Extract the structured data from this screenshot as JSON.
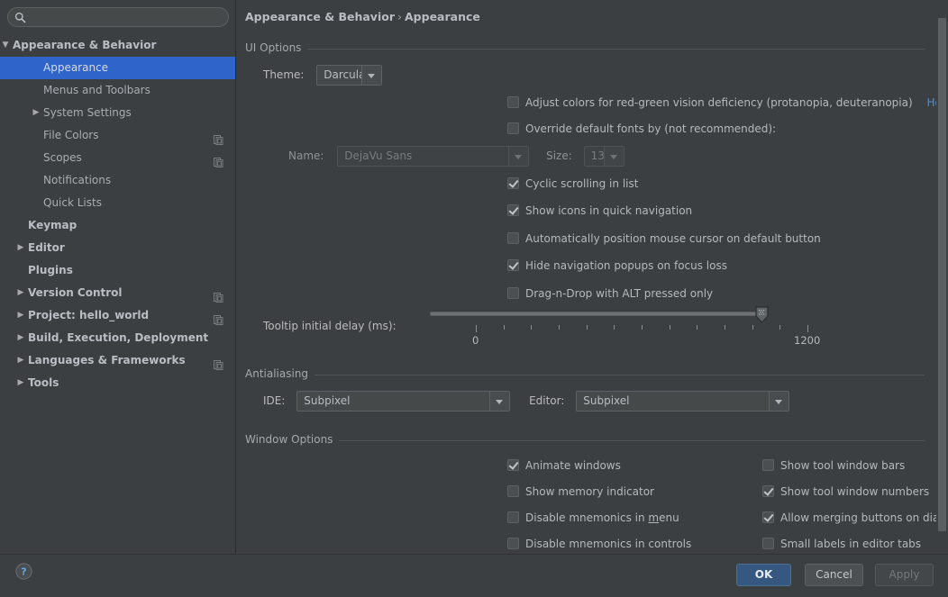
{
  "search": {
    "value": "",
    "placeholder": "",
    "icon": "search-icon"
  },
  "sidebar": {
    "items": [
      {
        "label": "Appearance & Behavior",
        "indent": 14,
        "arrow": "▼",
        "bold": true,
        "selected": false,
        "copy": false
      },
      {
        "label": "Appearance",
        "indent": 48,
        "arrow": "",
        "bold": false,
        "selected": true,
        "copy": false
      },
      {
        "label": "Menus and Toolbars",
        "indent": 48,
        "arrow": "",
        "bold": false,
        "selected": false,
        "copy": false
      },
      {
        "label": "System Settings",
        "indent": 48,
        "arrow": "▶",
        "bold": false,
        "selected": false,
        "copy": false
      },
      {
        "label": "File Colors",
        "indent": 48,
        "arrow": "",
        "bold": false,
        "selected": false,
        "copy": true
      },
      {
        "label": "Scopes",
        "indent": 48,
        "arrow": "",
        "bold": false,
        "selected": false,
        "copy": true
      },
      {
        "label": "Notifications",
        "indent": 48,
        "arrow": "",
        "bold": false,
        "selected": false,
        "copy": false
      },
      {
        "label": "Quick Lists",
        "indent": 48,
        "arrow": "",
        "bold": false,
        "selected": false,
        "copy": false
      },
      {
        "label": "Keymap",
        "indent": 31,
        "arrow": "",
        "bold": true,
        "selected": false,
        "copy": false
      },
      {
        "label": "Editor",
        "indent": 31,
        "arrow": "▶",
        "bold": true,
        "selected": false,
        "copy": false
      },
      {
        "label": "Plugins",
        "indent": 31,
        "arrow": "",
        "bold": true,
        "selected": false,
        "copy": false
      },
      {
        "label": "Version Control",
        "indent": 31,
        "arrow": "▶",
        "bold": true,
        "selected": false,
        "copy": true
      },
      {
        "label": "Project: hello_world",
        "indent": 31,
        "arrow": "▶",
        "bold": true,
        "selected": false,
        "copy": true
      },
      {
        "label": "Build, Execution, Deployment",
        "indent": 31,
        "arrow": "▶",
        "bold": true,
        "selected": false,
        "copy": false
      },
      {
        "label": "Languages & Frameworks",
        "indent": 31,
        "arrow": "▶",
        "bold": true,
        "selected": false,
        "copy": true
      },
      {
        "label": "Tools",
        "indent": 31,
        "arrow": "▶",
        "bold": true,
        "selected": false,
        "copy": false
      }
    ]
  },
  "breadcrumb": {
    "parent": "Appearance & Behavior",
    "separator": "›",
    "current": "Appearance"
  },
  "ui_options": {
    "group_title": "UI Options",
    "theme_label": "Theme:",
    "theme_value": "Darcula",
    "color_deficiency": {
      "label": "Adjust colors for red-green vision deficiency (protanopia, deuteranopia)",
      "checked": false,
      "link": "How it works"
    },
    "override_fonts": {
      "label": "Override default fonts by (not recommended):",
      "checked": false
    },
    "font_name_label": "Name:",
    "font_name_value": "DejaVu Sans",
    "font_size_label": "Size:",
    "font_size_value": "13",
    "checks": [
      {
        "label": "Cyclic scrolling in list",
        "checked": true
      },
      {
        "label": "Show icons in quick navigation",
        "checked": true
      },
      {
        "label": "Automatically position mouse cursor on default button",
        "checked": false
      },
      {
        "label": "Hide navigation popups on focus loss",
        "checked": true
      },
      {
        "label": "Drag-n-Drop with ALT pressed only",
        "checked": false
      }
    ],
    "tooltip_delay": {
      "label": "Tooltip initial delay (ms):",
      "min_label": "0",
      "max_label": "1200",
      "min": 0,
      "max": 1200,
      "value": 1200,
      "tick_count": 13
    }
  },
  "antialiasing": {
    "group_title": "Antialiasing",
    "ide_label": "IDE:",
    "ide_value": "Subpixel",
    "editor_label": "Editor:",
    "editor_value": "Subpixel"
  },
  "window_options": {
    "group_title": "Window Options",
    "left": [
      {
        "label": "Animate windows",
        "checked": true
      },
      {
        "label": "Show memory indicator",
        "checked": false
      },
      {
        "label": "Disable mnemonics in menu",
        "checked": false,
        "mnemonic": "m"
      },
      {
        "label": "Disable mnemonics in controls",
        "checked": false
      }
    ],
    "right": [
      {
        "label": "Show tool window bars",
        "checked": false
      },
      {
        "label": "Show tool window numbers",
        "checked": true
      },
      {
        "label": "Allow merging buttons on dialogs",
        "checked": true
      },
      {
        "label": "Small labels in editor tabs",
        "checked": false
      }
    ]
  },
  "footer": {
    "help": "?",
    "ok": "OK",
    "cancel": "Cancel",
    "apply": "Apply",
    "apply_disabled": true
  },
  "colors": {
    "background": "#3c3f41",
    "selection": "#2f65ca",
    "accent_link": "#528cc7",
    "primary_button": "#365880",
    "text": "#b4b9be"
  }
}
